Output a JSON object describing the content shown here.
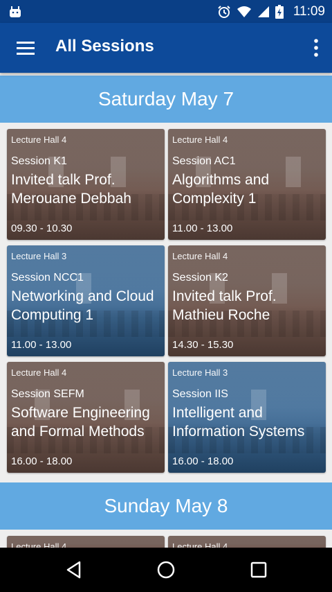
{
  "status_bar": {
    "time": "11:09"
  },
  "app_bar": {
    "title": "All Sessions"
  },
  "days": [
    {
      "label": "Saturday May 7",
      "sessions": [
        {
          "hall": "Lecture Hall 4",
          "session": "Session K1",
          "title": "Invited talk Prof. Merouane Debbah",
          "time": "09.30 - 10.30",
          "style": "brown"
        },
        {
          "hall": "Lecture Hall 4",
          "session": "Session AC1",
          "title": "Algorithms and Complexity 1",
          "time": "11.00 - 13.00",
          "style": "brown"
        },
        {
          "hall": "Lecture Hall 3",
          "session": "Session NCC1",
          "title": "Networking and Cloud Computing 1",
          "time": "11.00 - 13.00",
          "style": "blue"
        },
        {
          "hall": "Lecture Hall 4",
          "session": "Session K2",
          "title": "Invited talk Prof. Mathieu Roche",
          "time": "14.30 - 15.30",
          "style": "brown"
        },
        {
          "hall": "Lecture Hall 4",
          "session": "Session SEFM",
          "title": "Software Engineering and Formal Methods",
          "time": "16.00 - 18.00",
          "style": "brown"
        },
        {
          "hall": "Lecture Hall 3",
          "session": "Session IIS",
          "title": "Intelligent and Information Systems",
          "time": "16.00 - 18.00",
          "style": "blue"
        }
      ]
    },
    {
      "label": "Sunday May 8",
      "sessions": [
        {
          "hall": "Lecture Hall 4",
          "style": "brown"
        },
        {
          "hall": "Lecture Hall 4",
          "style": "brown"
        }
      ]
    }
  ],
  "icons": {
    "status": [
      "android-icon",
      "alarm-icon",
      "wifi-icon",
      "signal-icon",
      "battery-icon"
    ],
    "app_bar": [
      "menu-icon",
      "more-vert-icon"
    ],
    "nav": [
      "back-icon",
      "home-icon",
      "recents-icon"
    ]
  }
}
